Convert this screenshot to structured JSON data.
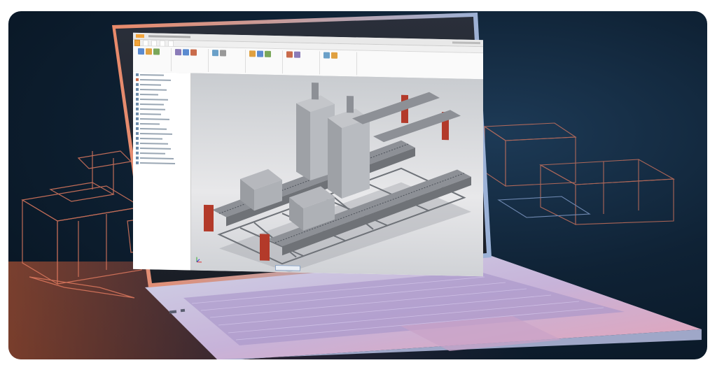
{
  "scene": {
    "subject": "laptop-cad-workstation",
    "colors": {
      "background": "#0f2235",
      "accent_glow": "#d6603a",
      "keyboard_tint": "#b9a6d8",
      "wireframe": "#e07a5f",
      "ribbon_active": "#f3a43a",
      "machine_red": "#b33a2a"
    }
  },
  "icons": [
    "axis-triad-icon",
    "ribbon-tool-icon"
  ]
}
